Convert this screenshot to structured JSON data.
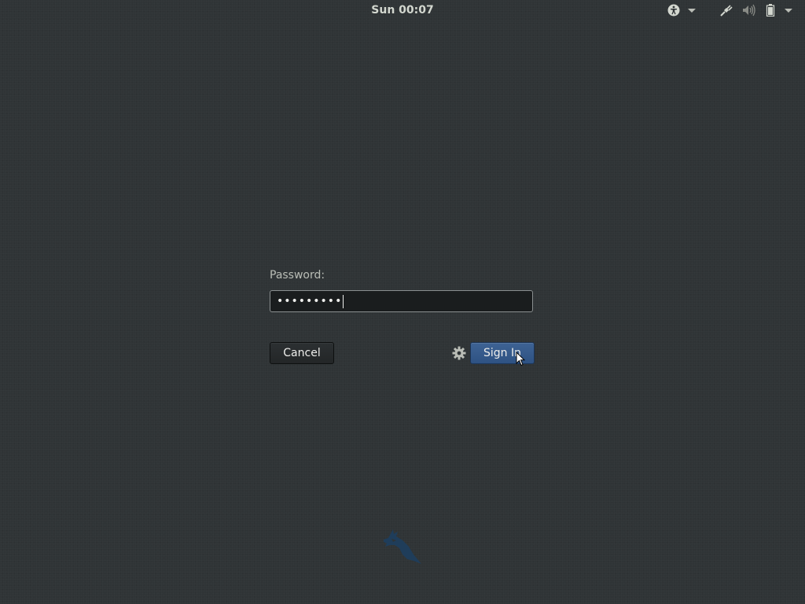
{
  "topbar": {
    "clock": "Sun 00:07",
    "icons": {
      "accessibility": "accessibility-icon",
      "network": "wired-network-icon",
      "volume": "volume-icon",
      "battery": "battery-icon",
      "menu_arrow": "chevron-down-icon"
    }
  },
  "login": {
    "password_label": "Password:",
    "password_value": "•••••••••",
    "cancel_label": "Cancel",
    "signin_label": "Sign In",
    "session_icon": "gear-icon"
  },
  "branding": {
    "logo": "distribution-logo"
  },
  "colors": {
    "background": "#2f3436",
    "accent": "#2e5283",
    "text": "#eeeeec",
    "label": "#babdb6"
  }
}
